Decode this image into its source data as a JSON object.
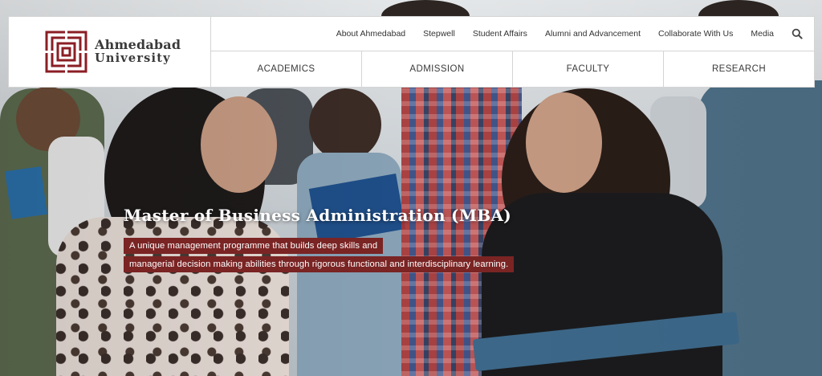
{
  "brand": {
    "name_line1": "Ahmedabad",
    "name_line2": "University",
    "logo_color": "#8b1e24"
  },
  "top_nav": {
    "items": [
      {
        "label": "About Ahmedabad"
      },
      {
        "label": "Stepwell"
      },
      {
        "label": "Student Affairs"
      },
      {
        "label": "Alumni and Advancement"
      },
      {
        "label": "Collaborate With Us"
      },
      {
        "label": "Media"
      }
    ],
    "search_icon": "search-icon"
  },
  "main_nav": {
    "items": [
      {
        "label": "ACADEMICS"
      },
      {
        "label": "ADMISSION"
      },
      {
        "label": "FACULTY"
      },
      {
        "label": "RESEARCH"
      }
    ]
  },
  "hero": {
    "title": "Master of Business Administration (MBA)",
    "subtitle_line1": "A unique management programme that builds deep skills and",
    "subtitle_line2": "managerial decision making abilities through rigorous functional and interdisciplinary learning.",
    "subtitle_bg": "#7a2424"
  }
}
